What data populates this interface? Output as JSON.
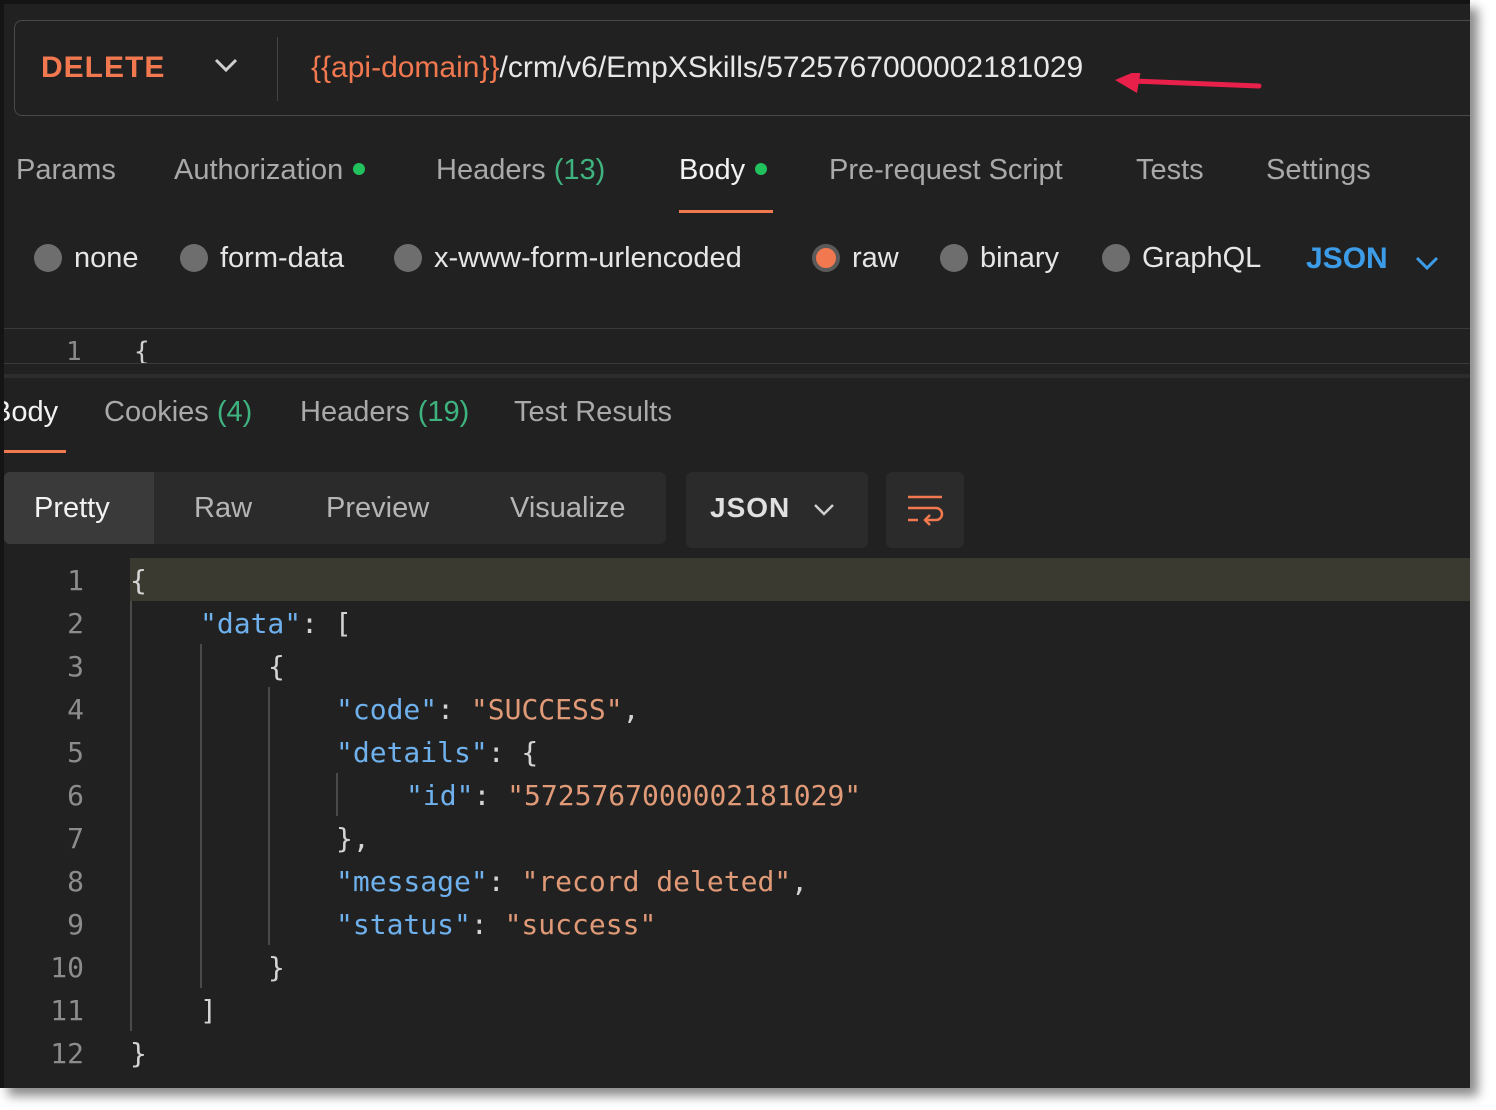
{
  "request": {
    "method": "DELETE",
    "url_variable": "{{api-domain}}",
    "url_path": "/crm/v6/EmpXSkills/5725767000002181029"
  },
  "request_tabs": [
    {
      "label": "Params",
      "count": "",
      "dot": false
    },
    {
      "label": "Authorization",
      "count": "",
      "dot": true
    },
    {
      "label": "Headers",
      "count": "(13)",
      "dot": false
    },
    {
      "label": "Body",
      "count": "",
      "dot": true,
      "active": true
    },
    {
      "label": "Pre-request Script",
      "count": "",
      "dot": false
    },
    {
      "label": "Tests",
      "count": "",
      "dot": false
    },
    {
      "label": "Settings",
      "count": "",
      "dot": false
    }
  ],
  "body_types": [
    {
      "label": "none",
      "selected": false
    },
    {
      "label": "form-data",
      "selected": false
    },
    {
      "label": "x-www-form-urlencoded",
      "selected": false
    },
    {
      "label": "raw",
      "selected": true
    },
    {
      "label": "binary",
      "selected": false
    },
    {
      "label": "GraphQL",
      "selected": false
    }
  ],
  "raw_format": "JSON",
  "request_editor": {
    "line": "1",
    "code": "{"
  },
  "response_tabs": [
    {
      "label": "Body",
      "count": "",
      "active": true
    },
    {
      "label": "Cookies",
      "count": "(4)"
    },
    {
      "label": "Headers",
      "count": "(19)"
    },
    {
      "label": "Test Results",
      "count": ""
    }
  ],
  "view_modes": [
    "Pretty",
    "Raw",
    "Preview",
    "Visualize"
  ],
  "response_format": "JSON",
  "response_lines": [
    {
      "n": "1",
      "tokens": [
        {
          "t": "{",
          "c": "p"
        }
      ]
    },
    {
      "n": "2",
      "tokens": [
        {
          "t": "\"data\"",
          "c": "k"
        },
        {
          "t": ": [",
          "c": "p"
        }
      ]
    },
    {
      "n": "3",
      "tokens": [
        {
          "t": "{",
          "c": "p"
        }
      ]
    },
    {
      "n": "4",
      "tokens": [
        {
          "t": "\"code\"",
          "c": "k"
        },
        {
          "t": ": ",
          "c": "p"
        },
        {
          "t": "\"SUCCESS\"",
          "c": "s"
        },
        {
          "t": ",",
          "c": "p"
        }
      ]
    },
    {
      "n": "5",
      "tokens": [
        {
          "t": "\"details\"",
          "c": "k"
        },
        {
          "t": ": {",
          "c": "p"
        }
      ]
    },
    {
      "n": "6",
      "tokens": [
        {
          "t": "\"id\"",
          "c": "k"
        },
        {
          "t": ": ",
          "c": "p"
        },
        {
          "t": "\"5725767000002181029\"",
          "c": "s"
        }
      ]
    },
    {
      "n": "7",
      "tokens": [
        {
          "t": "},",
          "c": "p"
        }
      ]
    },
    {
      "n": "8",
      "tokens": [
        {
          "t": "\"message\"",
          "c": "k"
        },
        {
          "t": ": ",
          "c": "p"
        },
        {
          "t": "\"record deleted\"",
          "c": "s"
        },
        {
          "t": ",",
          "c": "p"
        }
      ]
    },
    {
      "n": "9",
      "tokens": [
        {
          "t": "\"status\"",
          "c": "k"
        },
        {
          "t": ": ",
          "c": "p"
        },
        {
          "t": "\"success\"",
          "c": "s"
        }
      ]
    },
    {
      "n": "10",
      "tokens": [
        {
          "t": "}",
          "c": "p"
        }
      ]
    },
    {
      "n": "11",
      "tokens": [
        {
          "t": "]",
          "c": "p"
        }
      ]
    },
    {
      "n": "12",
      "tokens": [
        {
          "t": "}",
          "c": "p"
        }
      ]
    }
  ],
  "colors": {
    "accent": "#f1784f",
    "dot_green": "#21c25e",
    "count_green": "#3fb37f",
    "json_blue": "#3c9ce8",
    "key_blue": "#6fb1ed",
    "string_orange": "#e09a77",
    "annotation_arrow": "#e8204a"
  }
}
